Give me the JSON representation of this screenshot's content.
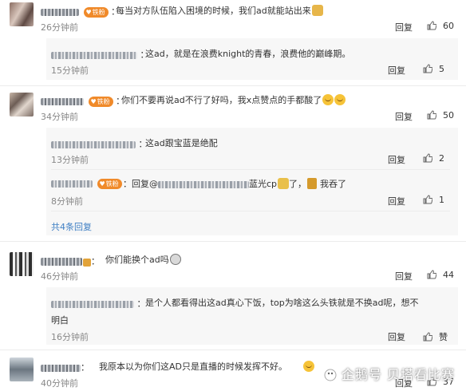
{
  "comments": [
    {
      "text": "每当对方队伍陷入困境的时候，我们ad就能站出来",
      "time": "26分钟前",
      "reply": "回复",
      "likes": "60",
      "fan": "铁粉"
    },
    {
      "text": "这ad，就是在浪费knight的青春，浪费他的巅峰期。",
      "time": "15分钟前",
      "reply": "回复",
      "likes": "5"
    },
    {
      "text": "你们不要再说ad不行了好吗，我x点赞点的手都酸了",
      "time": "34分钟前",
      "reply": "回复",
      "likes": "50",
      "fan": "铁粉"
    },
    {
      "text": "这ad跟宝蓝是绝配",
      "time": "13分钟前",
      "reply": "回复",
      "likes": "2"
    },
    {
      "prefix": "：回复@",
      "text": "蓝光cp",
      "suffix": "了，",
      "suffix2": "我吞了",
      "time": "8分钟前",
      "reply": "回复",
      "likes": "1",
      "fan": "铁粉"
    },
    {
      "text": "你们能换个ad吗",
      "time": "46分钟前",
      "reply": "回复",
      "likes": "44"
    },
    {
      "text": "是个人都看得出这ad真心下饭，top为啥这么头铁就是不换ad呢，想不",
      "text2": "明白",
      "time": "16分钟前",
      "reply": "回复",
      "likes": "赞"
    },
    {
      "text": "我原本以为你们这AD只是直播的时候发挥不好。",
      "time": "40分钟前",
      "reply": "回复",
      "likes": "37"
    }
  ],
  "expand_label": "共4条回复",
  "watermark": "企鹅号 贝塔看比赛",
  "accent_color": "#3f7fc4",
  "fan_color": "#f08a2a"
}
